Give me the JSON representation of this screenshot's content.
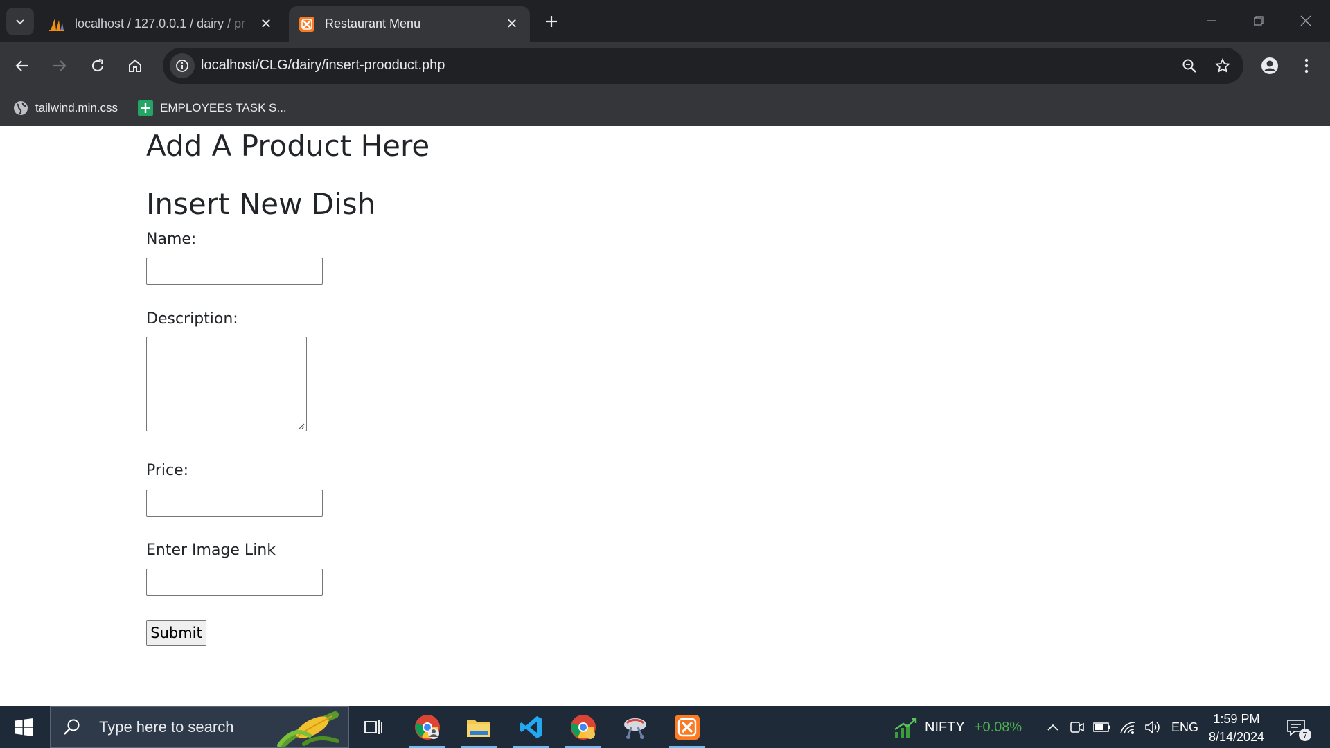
{
  "browser": {
    "tabs": [
      {
        "title": "localhost / 127.0.0.1 / dairy / pr",
        "active": false,
        "favicon": "phpmyadmin-sail-icon"
      },
      {
        "title": "Restaurant Menu",
        "active": true,
        "favicon": "xampp-icon"
      }
    ],
    "address": {
      "url": "localhost/CLG/dairy/insert-prooduct.php"
    },
    "bookmarks": [
      {
        "label": "tailwind.min.css",
        "icon": "globe-icon"
      },
      {
        "label": "EMPLOYEES TASK S...",
        "icon": "sheets-icon"
      }
    ]
  },
  "page": {
    "heading": "Add A Product Here",
    "form_title": "Insert New Dish",
    "fields": {
      "name_label": "Name:",
      "name_value": "",
      "description_label": "Description:",
      "description_value": "",
      "price_label": "Price:",
      "price_value": "",
      "image_label": "Enter Image Link",
      "image_value": ""
    },
    "submit_label": "Submit"
  },
  "taskbar": {
    "search_placeholder": "Type here to search",
    "nifty_label": "NIFTY",
    "nifty_change": "+0.08%",
    "language": "ENG",
    "time": "1:59 PM",
    "date": "8/14/2024",
    "notification_count": "7"
  },
  "colors": {
    "chrome_dark": "#202124",
    "chrome_toolbar": "#35363a",
    "taskbar": "#1f2a38",
    "nifty_positive": "#4caf50",
    "xampp_orange": "#fb7a24"
  }
}
